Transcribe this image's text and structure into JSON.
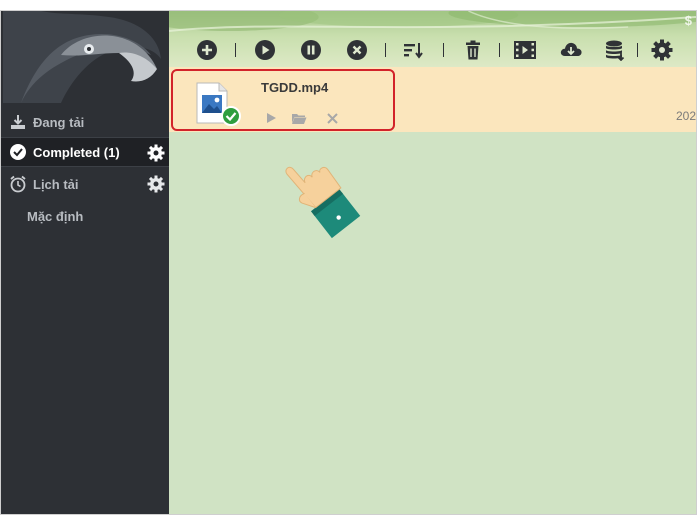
{
  "sidebar": {
    "items": [
      {
        "label": "Đang tải",
        "icon": "download-tray-icon"
      },
      {
        "label": "Completed (1)",
        "icon": "check-circle-icon",
        "active": true
      },
      {
        "label": "Lịch tải",
        "icon": "alarm-clock-icon"
      }
    ],
    "sub_items": [
      {
        "label": "Mặc định"
      }
    ]
  },
  "toolbar": {
    "buttons": [
      "add-icon",
      "play-icon",
      "pause-icon",
      "stop-icon",
      "sort-icon",
      "trash-icon",
      "video-grab-icon",
      "cloud-download-icon",
      "database-icon",
      "settings-gear-icon"
    ],
    "corner_text": "$"
  },
  "downloads": [
    {
      "filename": "TGDD.mp4",
      "status": "completed",
      "date_partial": "202",
      "actions": [
        "play-icon",
        "open-folder-icon",
        "remove-icon"
      ]
    }
  ],
  "colors": {
    "sidebar_bg": "#2d3035",
    "content_bg": "#d0e3c4",
    "row_bg": "#fbe6bd",
    "highlight": "#d2232a",
    "success": "#2e9e3f"
  }
}
